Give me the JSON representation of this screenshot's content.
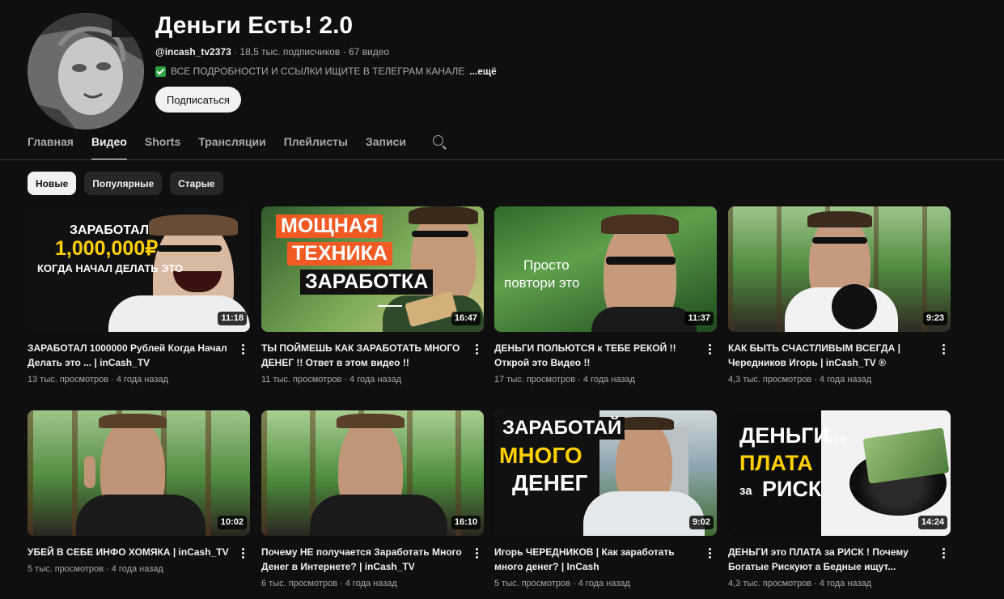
{
  "channel": {
    "title": "Деньги Есть! 2.0",
    "handle": "@incash_tv2373",
    "meta_rest": " · 18,5 тыс. подписчиков · 67 видео",
    "description": "ВСЕ ПОДРОБНОСТИ И ССЫЛКИ ИЩИТЕ В ТЕЛЕГРАМ КАНАЛЕ",
    "more_label": "...ещё",
    "subscribe_label": "Подписаться"
  },
  "tabs": [
    {
      "label": "Главная"
    },
    {
      "label": "Видео",
      "active": true
    },
    {
      "label": "Shorts"
    },
    {
      "label": "Трансляции"
    },
    {
      "label": "Плейлисты"
    },
    {
      "label": "Записи"
    }
  ],
  "chips": [
    {
      "label": "Новые",
      "selected": true
    },
    {
      "label": "Популярные"
    },
    {
      "label": "Старые"
    }
  ],
  "videos": [
    {
      "title": "ЗАРАБОТАЛ 1000000 Рублей Когда Начал Делать это ... | inCash_TV",
      "meta": "13 тыс. просмотров · 4 года назад",
      "duration": "11:18",
      "thumb_text": [
        "ЗАРАБОТАЛ",
        "1,000,000₽",
        "КОГДА НАЧАЛ ДЕЛАТЬ ЭТО"
      ]
    },
    {
      "title": "ТЫ ПОЙМЕШЬ КАК ЗАРАБОТАТЬ МНОГО ДЕНЕГ !! Ответ в этом видео !!",
      "meta": "11 тыс. просмотров · 4 года назад",
      "duration": "16:47",
      "thumb_text": [
        "МОЩНАЯ",
        "ТЕХНИКА",
        "ЗАРАБОТКА"
      ]
    },
    {
      "title": "ДЕНЬГИ ПОЛЬЮТСЯ к ТЕБЕ РЕКОЙ !! Открой это Видео !!",
      "meta": "17 тыс. просмотров · 4 года назад",
      "duration": "11:37",
      "thumb_text": [
        "Просто",
        "повтори это"
      ]
    },
    {
      "title": "КАК БЫТЬ СЧАСТЛИВЫМ ВСЕГДА | Чередников Игорь | inCash_TV ®",
      "meta": "4,3 тыс. просмотров · 4 года назад",
      "duration": "9:23"
    },
    {
      "title": "УБЕЙ В СЕБЕ ИНФО ХОМЯКА | inCash_TV",
      "meta": "5 тыс. просмотров · 4 года назад",
      "duration": "10:02"
    },
    {
      "title": "Почему НЕ получается Заработать Много Денег в Интернете? | inCash_TV",
      "meta": "6 тыс. просмотров · 4 года назад",
      "duration": "16:10"
    },
    {
      "title": "Игорь ЧЕРЕДНИКОВ | Как заработать много денег? | InCash",
      "meta": "5 тыс. просмотров · 4 года назад",
      "duration": "9:02",
      "thumb_text": [
        "ЗАРАБОТАЙ",
        "МНОГО",
        "ДЕНЕГ"
      ]
    },
    {
      "title": "ДЕНЬГИ это ПЛАТА за РИСК ! Почему Богатые Рискуют а Бедные ищут...",
      "meta": "4,3 тыс. просмотров · 4 года назад",
      "duration": "14:24",
      "thumb_text": [
        "ДЕНЬГИ",
        "это",
        "ПЛАТА",
        "за",
        "РИСК"
      ]
    }
  ],
  "colors": {
    "accent_yellow": "#ffd000",
    "accent_orange": "#f15a22",
    "bg": "#0f0f0f"
  }
}
